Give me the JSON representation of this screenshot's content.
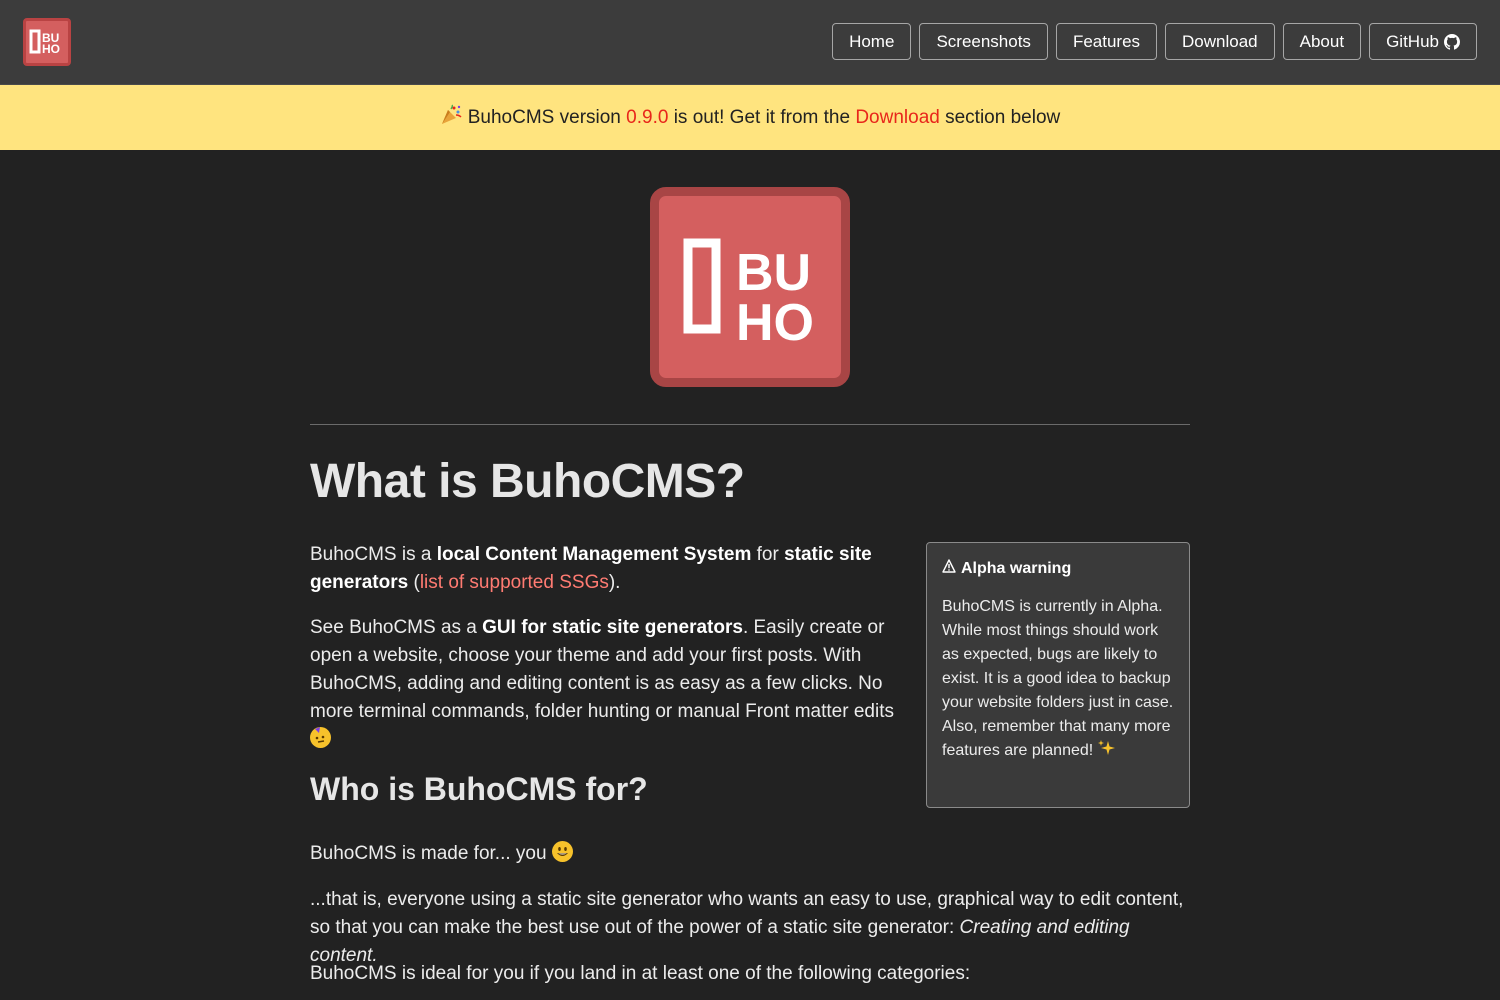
{
  "header": {
    "logo_alt": "BuhoCMS logo",
    "logo_text": {
      "top": "BU",
      "bottom": "HO"
    },
    "nav": [
      {
        "label": "Home"
      },
      {
        "label": "Screenshots"
      },
      {
        "label": "Features"
      },
      {
        "label": "Download"
      },
      {
        "label": "About"
      },
      {
        "label": "GitHub"
      }
    ]
  },
  "banner": {
    "icon": "party-popper-icon",
    "prefix": "BuhoCMS version ",
    "version": "0.9.0",
    "middle": " is out! Get it from the ",
    "link": "Download",
    "suffix": " section below"
  },
  "main": {
    "title": "What is BuhoCMS?",
    "p1": {
      "t1": "BuhoCMS is a ",
      "b1": "local Content Management System",
      "t2": " for ",
      "b2": "static site generators",
      "t3": " (",
      "link": "list of supported SSGs",
      "t4": ")."
    },
    "p2": {
      "t1": "See BuhoCMS as a ",
      "b1": "GUI for static site generators",
      "t2": ". Easily create or open a website, choose your theme and add your first posts. With BuhoCMS, adding and editing content is as easy as a few clicks. No more terminal commands, folder hunting or manual Front matter edits",
      "emoji": "partying-face-icon"
    },
    "subtitle": "Who is BuhoCMS for?",
    "p3": {
      "text": "BuhoCMS is made for... you",
      "emoji": "grinning-face-icon"
    },
    "p4": {
      "text": "...that is, everyone using a static site generator who wants an easy to use, graphical way to edit content, so that you can make the best use out of the power of a static site generator: ",
      "em": "Creating and editing content."
    },
    "p5": "BuhoCMS is ideal for you if you land in at least one of the following categories:"
  },
  "warning": {
    "icon": "warning-icon",
    "title": "Alpha warning",
    "body": "BuhoCMS is currently in Alpha. While most things should work as expected, bugs are likely to exist. It is a good idea to backup your website folders just in case. Also, remember that many more features are planned!",
    "emoji": "sparkles-icon"
  },
  "colors": {
    "background": "#222222",
    "header": "#3c3c3c",
    "banner": "#ffe47f",
    "accent_red": "#e8261b",
    "link": "#ff7b72",
    "logo": "#d45f5f"
  }
}
